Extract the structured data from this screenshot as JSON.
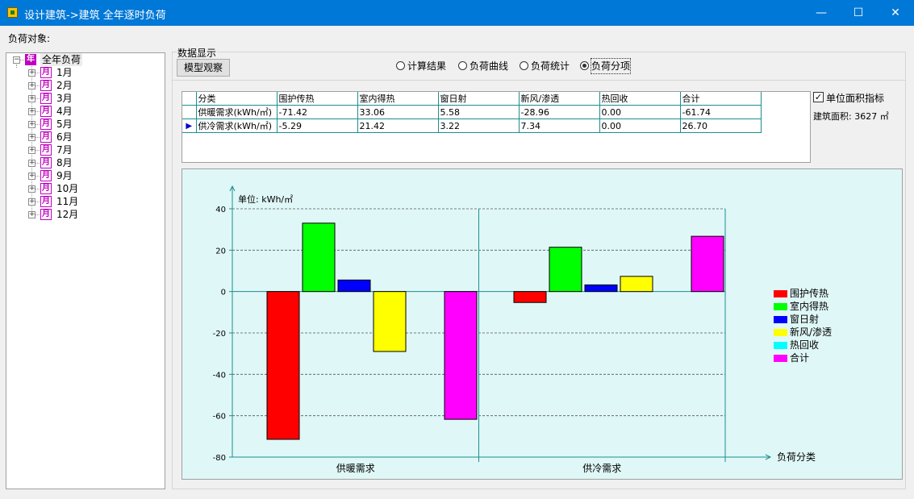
{
  "window": {
    "title": "设计建筑->建筑 全年逐时负荷",
    "minimize_glyph": "—",
    "maximize_glyph": "☐",
    "close_glyph": "✕"
  },
  "load_object_label": "负荷对象:",
  "tree": {
    "root": {
      "icon_text": "年",
      "label": "全年负荷"
    },
    "icon_text": "月",
    "items": [
      "1月",
      "2月",
      "3月",
      "4月",
      "5月",
      "6月",
      "7月",
      "8月",
      "9月",
      "10月",
      "11月",
      "12月"
    ]
  },
  "data_display": {
    "label": "数据显示",
    "model_view_button": "模型观察",
    "radios": [
      {
        "label": "计算结果",
        "selected": false
      },
      {
        "label": "负荷曲线",
        "selected": false
      },
      {
        "label": "负荷统计",
        "selected": false
      },
      {
        "label": "负荷分项",
        "selected": true
      }
    ]
  },
  "table": {
    "headers": [
      "分类",
      "围护传热",
      "室内得热",
      "窗日射",
      "新风/渗透",
      "热回收",
      "合计"
    ],
    "rows": [
      {
        "category": "供暖需求(kWh/㎡)",
        "values": [
          "-71.42",
          "33.06",
          "5.58",
          "-28.96",
          "0.00",
          "-61.74"
        ],
        "current": false
      },
      {
        "category": "供冷需求(kWh/㎡)",
        "values": [
          "-5.29",
          "21.42",
          "3.22",
          "7.34",
          "0.00",
          "26.70"
        ],
        "current": true
      }
    ],
    "current_row_marker": "▶"
  },
  "unit_area": {
    "label": "单位面积指标",
    "checked": true,
    "check_glyph": "✓"
  },
  "building_area": "建筑面积: 3627 ㎡",
  "chart_data": {
    "type": "bar",
    "unit_label": "单位: kWh/㎡",
    "xlabel": "负荷分类",
    "ylabel": "",
    "categories": [
      "供暖需求",
      "供冷需求"
    ],
    "ylim": [
      -80,
      40
    ],
    "yticks": [
      40,
      20,
      0,
      -20,
      -40,
      -60,
      -80
    ],
    "grid": true,
    "legend_position": "right",
    "series": [
      {
        "name": "围护传热",
        "color": "#ff0000",
        "values": [
          -71.42,
          -5.29
        ]
      },
      {
        "name": "室内得热",
        "color": "#00ff00",
        "values": [
          33.06,
          21.42
        ]
      },
      {
        "name": "窗日射",
        "color": "#0000ff",
        "values": [
          5.58,
          3.22
        ]
      },
      {
        "name": "新风/渗透",
        "color": "#ffff00",
        "values": [
          -28.96,
          7.34
        ]
      },
      {
        "name": "热回收",
        "color": "#00ffff",
        "values": [
          0.0,
          0.0
        ]
      },
      {
        "name": "合计",
        "color": "#ff00ff",
        "values": [
          -61.74,
          26.7
        ]
      }
    ]
  }
}
